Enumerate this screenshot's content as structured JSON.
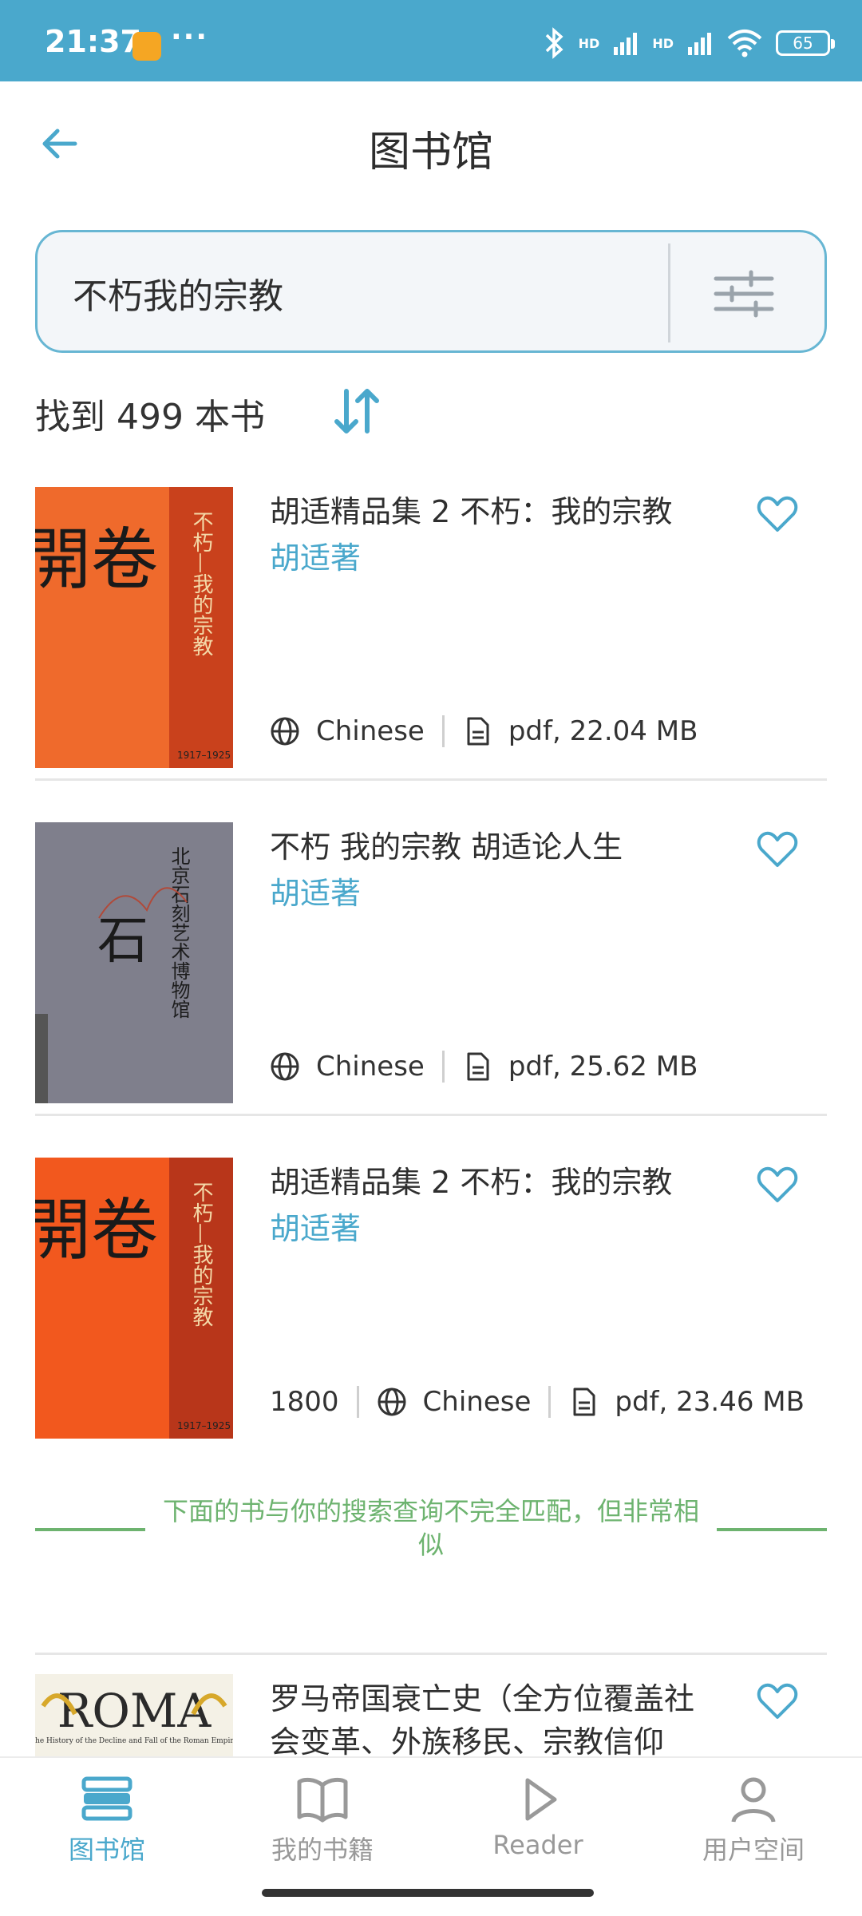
{
  "status_bar": {
    "time": "21:37",
    "dots": "···",
    "hd1": "HD",
    "hd2": "HD",
    "battery": "65"
  },
  "header": {
    "title": "图书馆"
  },
  "search": {
    "value": "不朽我的宗教"
  },
  "results": {
    "count_text": "找到 499 本书"
  },
  "books": [
    {
      "title": "胡适精品集 2 不朽：我的宗教",
      "author": "胡适著",
      "year": "",
      "language": "Chinese",
      "file": "pdf, 22.04 MB",
      "cover_text_a": "開卷",
      "cover_text_b": "不朽—我的宗教",
      "cover_text_c": "1917–1925"
    },
    {
      "title": "不朽 我的宗教 胡适论人生",
      "author": "胡适著",
      "year": "",
      "language": "Chinese",
      "file": "pdf, 25.62 MB",
      "cover_text_a": "北京石刻艺术博物馆",
      "cover_text_b": "石",
      "cover_text_c": ""
    },
    {
      "title": "胡适精品集 2 不朽：我的宗教",
      "author": "胡适著",
      "year": "1800",
      "language": "Chinese",
      "file": "pdf, 23.46 MB",
      "cover_text_a": "開卷",
      "cover_text_b": "不朽—我的宗教",
      "cover_text_c": "1917–1925"
    },
    {
      "title": "罗马帝国衰亡史（全方位覆盖社会变革、外族移民、宗教信仰",
      "author": "",
      "year": "",
      "language": "",
      "file": "",
      "cover_text_a": "ROMA",
      "cover_text_b": "The History of the Decline and Fall of the Roman Empire",
      "cover_text_c": ""
    }
  ],
  "similar_note": "下面的书与你的搜索查询不完全匹配，但非常相似",
  "nav": {
    "library": "图书馆",
    "my_books": "我的书籍",
    "reader": "Reader",
    "user_space": "用户空间"
  },
  "colors": {
    "accent": "#4aa8cc",
    "green": "#6db36f",
    "status_bar": "#4aa8cc"
  }
}
